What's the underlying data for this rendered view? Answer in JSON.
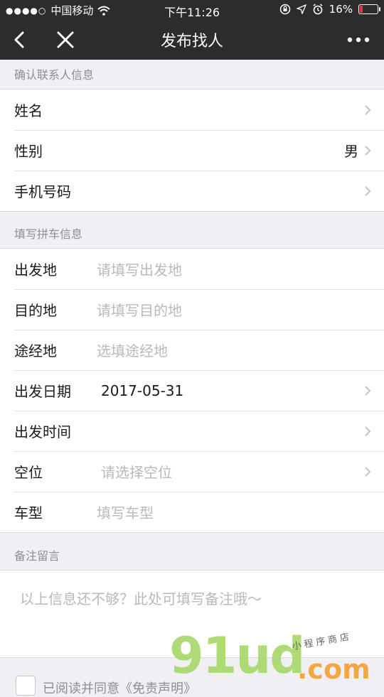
{
  "status_bar": {
    "carrier": "中国移动",
    "time": "下午11:26",
    "battery": "16%"
  },
  "nav": {
    "title": "发布找人"
  },
  "contact_section": {
    "header": "确认联系人信息",
    "rows": [
      {
        "label": "姓名",
        "value": ""
      },
      {
        "label": "性别",
        "value": "男"
      },
      {
        "label": "手机号码",
        "value": ""
      }
    ]
  },
  "carpool_section": {
    "header": "填写拼车信息",
    "rows": [
      {
        "label": "出发地",
        "placeholder": "请填写出发地"
      },
      {
        "label": "目的地",
        "placeholder": "请填写目的地"
      },
      {
        "label": "途经地",
        "placeholder": "选填途经地"
      },
      {
        "label": "出发日期",
        "value": "2017-05-31"
      },
      {
        "label": "出发时间",
        "value": ""
      },
      {
        "label": "空位",
        "placeholder": "请选择空位"
      },
      {
        "label": "车型",
        "placeholder": "填写车型"
      }
    ]
  },
  "notes_section": {
    "header": "备注留言",
    "placeholder": "以上信息还不够？此处可填写备注哦～"
  },
  "agreement": {
    "text": "已阅读并同意《免责声明》"
  },
  "watermark": {
    "brand": "91ud",
    "suffix": ".com",
    "tagline": "小程序商店"
  }
}
